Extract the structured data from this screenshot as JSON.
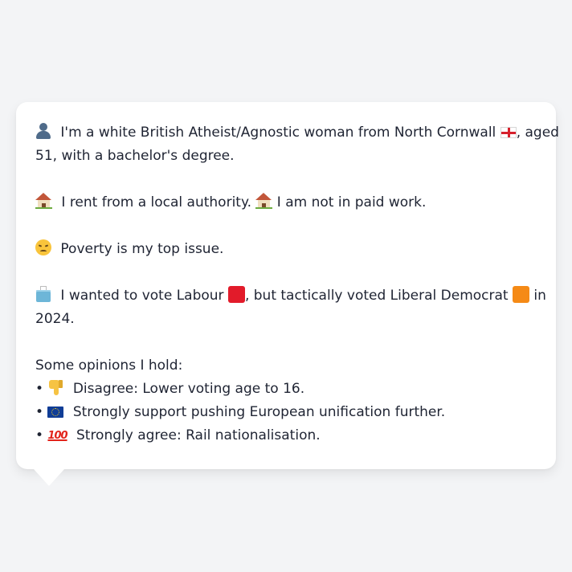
{
  "message": {
    "line1a": " I'm a white British Atheist/Agnostic woman from North Cornwall ",
    "line1b": ", aged",
    "line2": "51, with a bachelor's degree.",
    "line3a": " I rent from a local authority. ",
    "line3b": " I am not in paid work.",
    "line4": " Poverty is my top issue.",
    "line5a": " I wanted to vote Labour ",
    "line5b": ", but tactically voted Liberal Democrat ",
    "line5c": " in",
    "line6": "2024.",
    "opinions_heading": "Some opinions I hold:",
    "opinions": [
      " Disagree: Lower voting age to 16.",
      " Strongly support pushing European unification further.",
      " Strongly agree: Rail nationalisation."
    ],
    "bullet": "•",
    "hundred_glyph": "100"
  },
  "icons": {
    "person": "bust-in-silhouette-icon",
    "england_flag": "flag-england-icon",
    "house": "house-icon",
    "face": "disappointed-face-icon",
    "ballot": "ballot-box-icon",
    "labour": "red-square-icon",
    "libdem": "orange-square-icon",
    "thumb": "thumbs-down-icon",
    "eu": "eu-flag-icon",
    "hundred": "hundred-points-icon"
  },
  "colors": {
    "background": "#f3f4f6",
    "bubble": "#ffffff",
    "text": "#1f2433",
    "labour": "#e21b2a",
    "libdem": "#f58a16"
  }
}
